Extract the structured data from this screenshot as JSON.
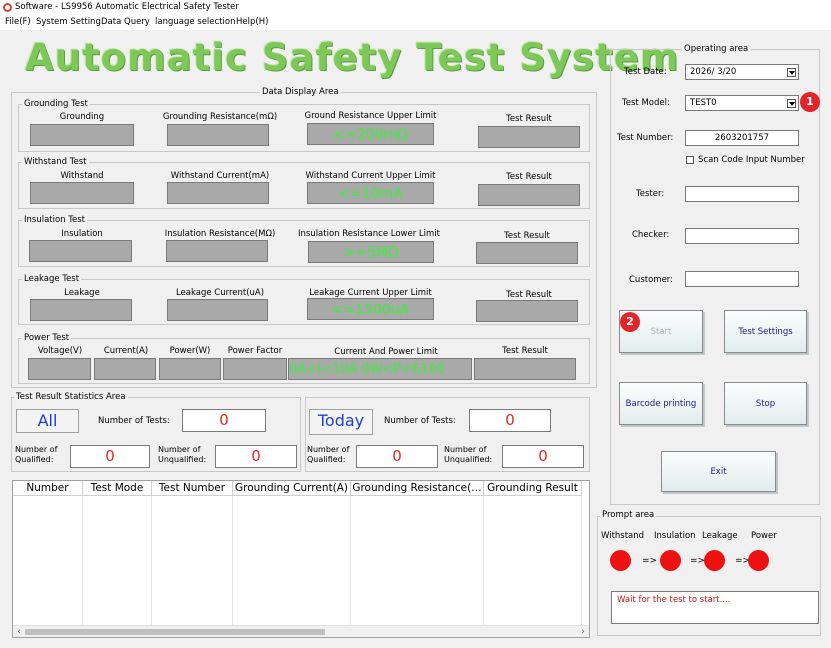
{
  "window": {
    "title": "Software - LS9956 Automatic Electrical Safety Tester"
  },
  "menu": [
    "File(F)",
    "System Setting",
    "Data Query",
    "language selection",
    "Help(H)"
  ],
  "main_title": "Automatic Safety Test System",
  "data_display_area": {
    "title": "Data Display Area",
    "grounding": {
      "title": "Grounding Test",
      "col1": "Grounding",
      "col2": "Grounding Resistance(mΩ)",
      "col3": "Ground Resistance Upper Limit",
      "col4": "Test Result",
      "limit": "<=200mΩ"
    },
    "withstand": {
      "title": "Withstand Test",
      "col1": "Withstand",
      "col2": "Withstand Current(mA)",
      "col3": "Withstand Current Upper Limit",
      "col4": "Test Result",
      "limit": "<=10mA"
    },
    "insulation": {
      "title": "Insulation Test",
      "col1": "Insulation",
      "col2": "Insulation Resistance(MΩ)",
      "col3": "Insulation Resistance Lower Limit",
      "col4": "Test Result",
      "limit": ">=5MΩ"
    },
    "leakage": {
      "title": "Leakage Test",
      "col1": "Leakage",
      "col2": "Leakage Current(uA)",
      "col3": "Leakage Current Upper Limit",
      "col4": "Test Result",
      "limit": "<=1500uA"
    },
    "power": {
      "title": "Power Test",
      "col1": "Voltage(V)",
      "col2": "Current(A)",
      "col3": "Power(W)",
      "col4": "Power Factor",
      "col5": "Current And Power Limit",
      "col6": "Test Result",
      "limit": "0A<I<10A 0W<P<6100"
    }
  },
  "statistics": {
    "title": "Test Result Statistics Area",
    "all": {
      "label": "All",
      "tests_label": "Number of Tests:",
      "tests": "0",
      "qualified_label": "Number of Qualified:",
      "qualified": "0",
      "unqualified_label": "Number of Unqualified:",
      "unqualified": "0"
    },
    "today": {
      "label": "Today",
      "tests_label": "Number of Tests:",
      "tests": "0",
      "qualified_label": "Number of Qualified:",
      "qualified": "0",
      "unqualified_label": "Number of Unqualified:",
      "unqualified": "0"
    }
  },
  "table": {
    "columns": [
      "Number",
      "Test Mode",
      "Test Number",
      "Grounding Current(A)",
      "Grounding Resistance(…",
      "Grounding Result"
    ]
  },
  "operating": {
    "title": "Operating area",
    "test_date_label": "Test Date:",
    "test_date": "2026/  3/20",
    "test_model_label": "Test Model:",
    "test_model": "TEST0",
    "test_number_label": "Test Number:",
    "test_number": "2603201757",
    "scan_label": "Scan Code Input Number",
    "tester_label": "Tester:",
    "checker_label": "Checker:",
    "customer_label": "Customer:",
    "start_label": "Start",
    "settings_label": "Test Settings",
    "barcode_label": "Barcode printing",
    "stop_label": "Stop",
    "exit_label": "Exit",
    "badge1": "1",
    "badge2": "2"
  },
  "prompt": {
    "title": "Prompt area",
    "withstand": "Withstand",
    "insulation": "Insulation",
    "leakage": "Leakage",
    "power": "Power",
    "arrow": "=>",
    "message": "Wait for the test to start....",
    "status_color": "#ee1111"
  }
}
